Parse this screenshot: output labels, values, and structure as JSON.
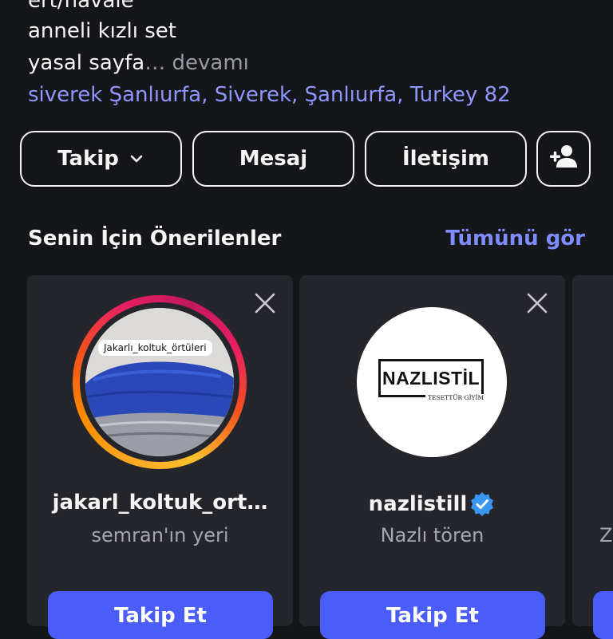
{
  "bio": {
    "cut_line": "ert/havale",
    "line1": "anneli kızlı set",
    "line2": "yasal sayfa",
    "more_label": "… devamı",
    "location": "siverek Şanlıurfa, Siverek, Şanlıurfa, Turkey 82"
  },
  "actions": {
    "follow": "Takip",
    "message": "Mesaj",
    "contact": "İletişim"
  },
  "suggestions": {
    "title": "Senin İçin Önerilenler",
    "see_all": "Tümünü gör",
    "items": [
      {
        "username": "jakarl_koltuk_ort…",
        "subtitle": "semran'ın yeri",
        "photo_label": "Jakarlı_koltuk_örtüleri",
        "follow": "Takip Et",
        "has_story_ring": true
      },
      {
        "username": "nazlistill",
        "subtitle": "Nazlı tören",
        "logo_text": "NAZLISTİL",
        "logo_subtext": "TESETTÜR GİYİM",
        "follow": "Takip Et",
        "verified": true
      },
      {
        "subtitle": "Ze"
      }
    ]
  },
  "colors": {
    "background": "#15161a",
    "card": "#25262c",
    "link": "#8f97ff",
    "see_all": "#7f8cff",
    "primary_button": "#4a5df9",
    "verified": "#3897f0"
  }
}
